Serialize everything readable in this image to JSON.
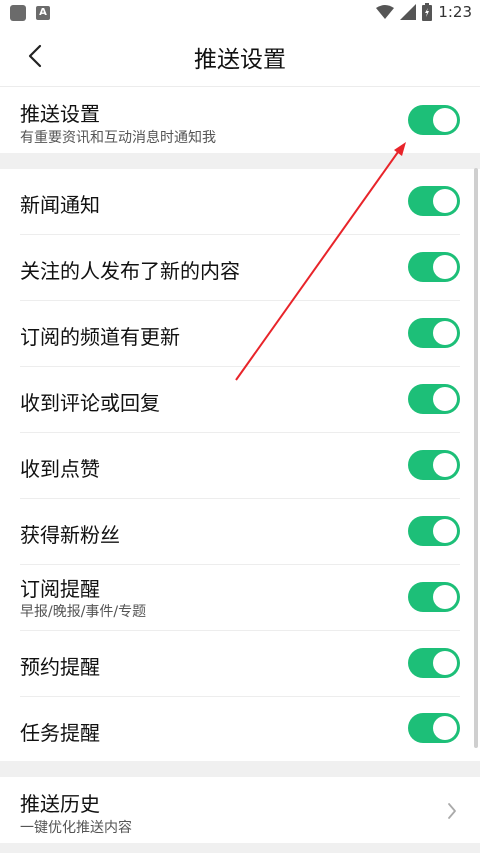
{
  "status_bar": {
    "time": "1:23"
  },
  "header": {
    "title": "推送设置"
  },
  "master": {
    "label": "推送设置",
    "sub": "有重要资讯和互动消息时通知我",
    "enabled": true
  },
  "items": [
    {
      "label": "新闻通知",
      "enabled": true
    },
    {
      "label": "关注的人发布了新的内容",
      "enabled": true
    },
    {
      "label": "订阅的频道有更新",
      "enabled": true
    },
    {
      "label": "收到评论或回复",
      "enabled": true
    },
    {
      "label": "收到点赞",
      "enabled": true
    },
    {
      "label": "获得新粉丝",
      "enabled": true
    },
    {
      "label": "订阅提醒",
      "sub": "早报/晚报/事件/专题",
      "enabled": true
    },
    {
      "label": "预约提醒",
      "enabled": true
    },
    {
      "label": "任务提醒",
      "enabled": true
    }
  ],
  "history": {
    "label": "推送历史",
    "sub": "一键优化推送内容"
  },
  "colors": {
    "toggle_on": "#1dbf78",
    "annotation_arrow": "#e8242a"
  }
}
